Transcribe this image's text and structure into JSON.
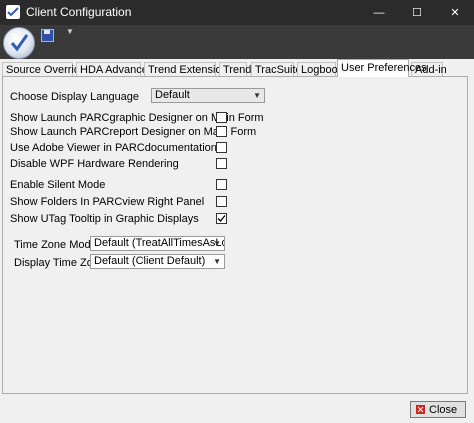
{
  "window": {
    "title": "Client Configuration",
    "minimize_glyph": "—",
    "maximize_glyph": "☐",
    "close_glyph": "✕"
  },
  "quick_access": {
    "dropdown_glyph": "▼"
  },
  "tabs": [
    {
      "label": "Source Overrides",
      "active": false
    },
    {
      "label": "HDA Advanced",
      "active": false
    },
    {
      "label": "Trend Extensions",
      "active": false
    },
    {
      "label": "Trend",
      "active": false
    },
    {
      "label": "TracSuite",
      "active": false
    },
    {
      "label": "Logbook",
      "active": false
    },
    {
      "label": "User Preferences",
      "active": true
    },
    {
      "label": "Add-in",
      "active": false
    }
  ],
  "preferences": {
    "display_language_label": "Choose Display Language",
    "display_language_value": "Default",
    "checkboxes": [
      {
        "label": "Show Launch PARCgraphic Designer on Main Form",
        "checked": false
      },
      {
        "label": "Show Launch PARCreport Designer on Main Form",
        "checked": false
      },
      {
        "label": "Use Adobe Viewer in PARCdocumentation",
        "checked": false
      },
      {
        "label": "Disable WPF Hardware Rendering",
        "checked": false
      },
      {
        "label": "Enable Silent Mode",
        "checked": false
      },
      {
        "label": "Show Folders In PARCview Right Panel",
        "checked": false
      },
      {
        "label": "Show UTag Tooltip in Graphic Displays",
        "checked": true
      }
    ],
    "time_zone_mode_label": "Time Zone Mode",
    "time_zone_mode_value": "Default (TreatAllTimesAsLoca",
    "display_time_zone_label": "Display Time Zone",
    "display_time_zone_value": "Default (Client Default)",
    "dropdown_glyph": "▼"
  },
  "footer": {
    "close_label": "Close"
  },
  "colors": {
    "titlebar": "#2b2b2b",
    "toolbar": "#3a3a3a",
    "background": "#f0f0f0",
    "close_icon": "#c8261f"
  },
  "icons": {
    "app": "checklist-icon",
    "save": "floppy-disk-icon",
    "close": "close-x-icon"
  }
}
